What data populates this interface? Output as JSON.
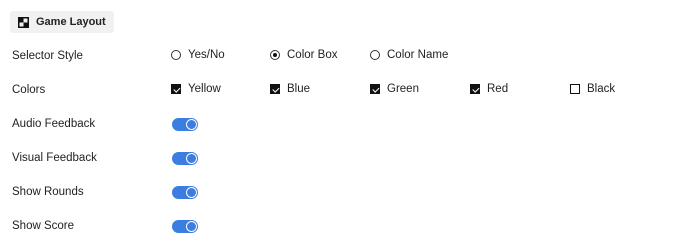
{
  "tab": {
    "label": "Game Layout",
    "icon": "layout-icon"
  },
  "selector_style": {
    "label": "Selector Style",
    "options": [
      {
        "label": "Yes/No",
        "selected": false
      },
      {
        "label": "Color Box",
        "selected": true
      },
      {
        "label": "Color Name",
        "selected": false
      }
    ]
  },
  "colors": {
    "label": "Colors",
    "options": [
      {
        "label": "Yellow",
        "checked": true
      },
      {
        "label": "Blue",
        "checked": true
      },
      {
        "label": "Green",
        "checked": true
      },
      {
        "label": "Red",
        "checked": true
      },
      {
        "label": "Black",
        "checked": false
      }
    ]
  },
  "toggles": [
    {
      "label": "Audio Feedback",
      "on": true
    },
    {
      "label": "Visual Feedback",
      "on": true
    },
    {
      "label": "Show Rounds",
      "on": true
    },
    {
      "label": "Show Score",
      "on": true
    }
  ],
  "accent_color": "#3b7de0"
}
